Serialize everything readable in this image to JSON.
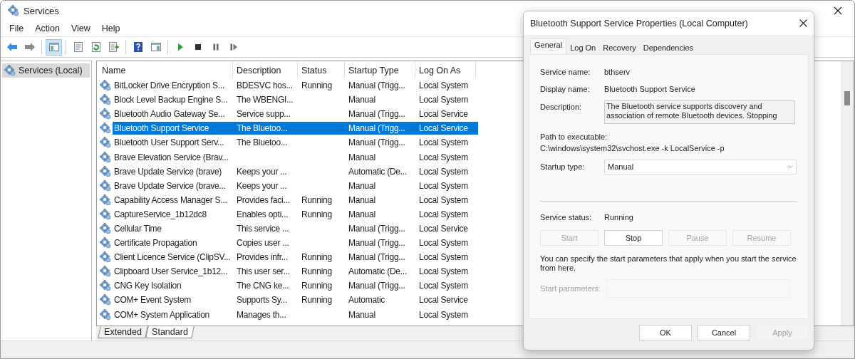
{
  "window": {
    "title": "Services",
    "menu": [
      "File",
      "Action",
      "View",
      "Help"
    ]
  },
  "toolbar": [
    {
      "kind": "back",
      "pressed": false
    },
    {
      "kind": "forward",
      "pressed": false
    },
    {
      "kind": "tree",
      "pressed": true
    },
    {
      "kind": "sheet",
      "pressed": false
    },
    {
      "kind": "refresh",
      "pressed": false
    },
    {
      "kind": "export",
      "pressed": false
    },
    {
      "kind": "help",
      "pressed": false
    },
    {
      "kind": "pane",
      "pressed": false
    },
    {
      "kind": "play",
      "pressed": false
    },
    {
      "kind": "stop",
      "pressed": false
    },
    {
      "kind": "pause",
      "pressed": false
    },
    {
      "kind": "resume",
      "pressed": false
    }
  ],
  "tree": [
    {
      "label": "Services (Local)",
      "selected": true
    }
  ],
  "table": {
    "columns": [
      "Name",
      "Description",
      "Status",
      "Startup Type",
      "Log On As"
    ],
    "rows": [
      {
        "cells": [
          "BitLocker Drive Encryption S...",
          "BDESVC hos...",
          "Running",
          "Manual (Trigg...",
          "Local System"
        ],
        "selected": false
      },
      {
        "cells": [
          "Block Level Backup Engine S...",
          "The WBENGI...",
          "",
          "Manual",
          "Local System"
        ],
        "selected": false
      },
      {
        "cells": [
          "Bluetooth Audio Gateway Se...",
          "Service supp...",
          "",
          "Manual (Trigg...",
          "Local Service"
        ],
        "selected": false
      },
      {
        "cells": [
          "Bluetooth Support Service",
          "The Bluetoo...",
          "",
          "Manual (Trigg...",
          "Local Service"
        ],
        "selected": true
      },
      {
        "cells": [
          "Bluetooth User Support Serv...",
          "The Bluetoo...",
          "",
          "Manual (Trigg...",
          "Local System"
        ],
        "selected": false
      },
      {
        "cells": [
          "Brave Elevation Service (Brav...",
          "",
          "",
          "Manual",
          "Local System"
        ],
        "selected": false
      },
      {
        "cells": [
          "Brave Update Service (brave)",
          "Keeps your ...",
          "",
          "Automatic (De...",
          "Local System"
        ],
        "selected": false
      },
      {
        "cells": [
          "Brave Update Service (brave...",
          "Keeps your ...",
          "",
          "Manual",
          "Local System"
        ],
        "selected": false
      },
      {
        "cells": [
          "Capability Access Manager S...",
          "Provides faci...",
          "Running",
          "Manual",
          "Local System"
        ],
        "selected": false
      },
      {
        "cells": [
          "CaptureService_1b12dc8",
          "Enables opti...",
          "Running",
          "Manual",
          "Local System"
        ],
        "selected": false
      },
      {
        "cells": [
          "Cellular Time",
          "This service ...",
          "",
          "Manual (Trigg...",
          "Local Service"
        ],
        "selected": false
      },
      {
        "cells": [
          "Certificate Propagation",
          "Copies user ...",
          "",
          "Manual (Trigg...",
          "Local System"
        ],
        "selected": false
      },
      {
        "cells": [
          "Client Licence Service (ClipSV...",
          "Provides infr...",
          "Running",
          "Manual (Trigg...",
          "Local System"
        ],
        "selected": false
      },
      {
        "cells": [
          "Clipboard User Service_1b12...",
          "This user ser...",
          "Running",
          "Automatic (De...",
          "Local System"
        ],
        "selected": false
      },
      {
        "cells": [
          "CNG Key Isolation",
          "The CNG ke...",
          "Running",
          "Manual (Trigg...",
          "Local System"
        ],
        "selected": false
      },
      {
        "cells": [
          "COM+ Event System",
          "Supports Sy...",
          "Running",
          "Automatic",
          "Local Service"
        ],
        "selected": false
      },
      {
        "cells": [
          "COM+ System Application",
          "Manages th...",
          "",
          "Manual",
          "Local System"
        ],
        "selected": false
      }
    ]
  },
  "view_tabs": [
    {
      "label": "Extended",
      "selected": false
    },
    {
      "label": "Standard",
      "selected": true
    }
  ],
  "dialog": {
    "title": "Bluetooth Support Service Properties (Local Computer)",
    "tabs": [
      {
        "label": "General",
        "selected": true
      },
      {
        "label": "Log On",
        "selected": false
      },
      {
        "label": "Recovery",
        "selected": false
      },
      {
        "label": "Dependencies",
        "selected": false
      }
    ],
    "service_name": {
      "label": "Service name:",
      "value": "bthserv"
    },
    "display_name": {
      "label": "Display name:",
      "value": "Bluetooth Support Service"
    },
    "description": {
      "label": "Description:",
      "value": "The Bluetooth service supports discovery and association of remote Bluetooth devices.  Stopping"
    },
    "path": {
      "label": "Path to executable:",
      "value": "C:\\windows\\system32\\svchost.exe -k LocalService -p"
    },
    "startup_type": {
      "label": "Startup type:",
      "value": "Manual"
    },
    "service_status": {
      "label": "Service status:",
      "value": "Running"
    },
    "control_buttons": [
      {
        "label": "Start",
        "disabled": true
      },
      {
        "label": "Stop",
        "disabled": false
      },
      {
        "label": "Pause",
        "disabled": true
      },
      {
        "label": "Resume",
        "disabled": true
      }
    ],
    "hint": "You can specify the start parameters that apply when you start the service from here.",
    "start_parameters": {
      "label": "Start parameters:",
      "disabled": true
    },
    "buttons": [
      {
        "label": "OK",
        "disabled": false
      },
      {
        "label": "Cancel",
        "disabled": false
      },
      {
        "label": "Apply",
        "disabled": true
      }
    ]
  }
}
